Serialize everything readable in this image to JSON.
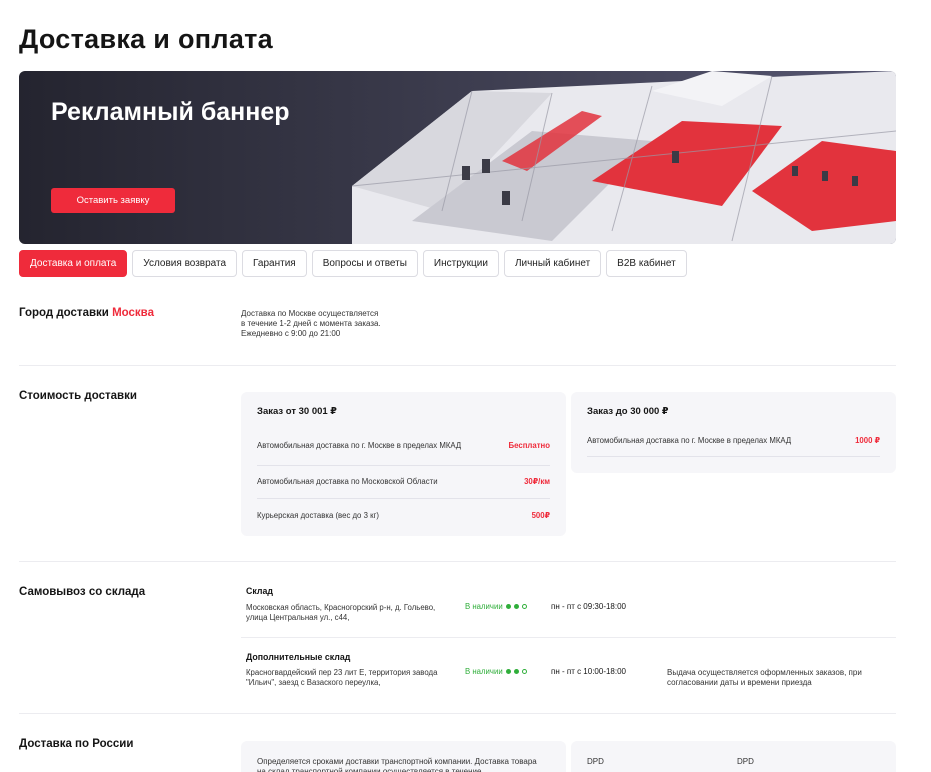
{
  "page": {
    "title": "Доставка и оплата"
  },
  "banner": {
    "title": "Рекламный баннер",
    "button_label": "Оставить заявку"
  },
  "tabs": [
    {
      "label": "Доставка и оплата",
      "active": true
    },
    {
      "label": "Условия возврата",
      "active": false
    },
    {
      "label": "Гарантия",
      "active": false
    },
    {
      "label": "Вопросы и ответы",
      "active": false
    },
    {
      "label": "Инструкции",
      "active": false
    },
    {
      "label": "Личный кабинет",
      "active": false
    },
    {
      "label": "B2B кабинет",
      "active": false
    }
  ],
  "city": {
    "heading": "Город доставки",
    "name": "Москва",
    "info_line1": "Доставка по Москве осуществляется",
    "info_line2": "в течение 1-2 дней с момента заказа.",
    "info_line3": "Ежедневно с 9:00 до 21:00"
  },
  "cost": {
    "heading": "Стоимость доставки",
    "card1": {
      "title": "Заказ от 30 001 ₽",
      "rows": [
        {
          "label": "Автомобильная доставка по г. Москве в пределах МКАД",
          "price": "Бесплатно"
        },
        {
          "label": "Автомобильная доставка по Московской Области",
          "price": "30₽/км"
        },
        {
          "label": "Курьерская доставка (вес до 3 кг)",
          "price": "500₽"
        }
      ]
    },
    "card2": {
      "title": "Заказ до 30 000 ₽",
      "rows": [
        {
          "label": "Автомобильная доставка по г. Москве в пределах МКАД",
          "price": "1000 ₽"
        }
      ]
    }
  },
  "pickup": {
    "heading": "Самовывоз со склада",
    "warehouses": [
      {
        "name": "Склад",
        "address": "Московская область, Красногорский р-н, д. Гольево, улица Центральная ул., с44,",
        "stock": "В наличии",
        "hours": "пн - пт с 09:30-18:00",
        "note": ""
      },
      {
        "name": "Дополнительные склад",
        "address": "Красногвардейский пер 23 лит Е, территория завода \"Ильич\", заезд с Вазаского переулка,",
        "stock": "В наличии",
        "hours": "пн - пт с 10:00-18:00",
        "note": "Выдача осуществляется оформленных заказов, при согласовании даты и времени приезда"
      }
    ]
  },
  "russia": {
    "heading": "Доставка по России",
    "text": "Определяется сроками доставки транспортной компании. Доставка товара на склад транспортной компании осуществляется в течение",
    "carriers": [
      "DPD",
      "DPD"
    ]
  },
  "colors": {
    "accent": "#ef2b3b",
    "stock_green": "#2fae3a",
    "card_bg": "#f6f6f9"
  }
}
